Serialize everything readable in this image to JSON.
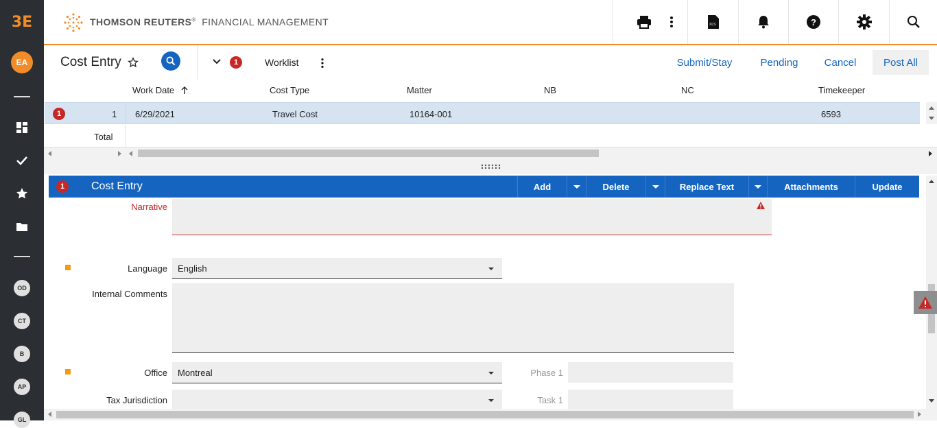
{
  "app": {
    "logo": "3E",
    "brand_bold": "THOMSON REUTERS",
    "brand_mark": "®",
    "brand_rest": "FINANCIAL MANAGEMENT"
  },
  "sidebar": {
    "user_initials": "EA",
    "recent": [
      "OD",
      "CT",
      "B",
      "AP",
      "GL"
    ]
  },
  "titlebar": {
    "title": "Cost Entry",
    "worklist_badge": "1",
    "worklist_label": "Worklist",
    "actions": [
      "Submit/Stay",
      "Pending",
      "Cancel",
      "Post All"
    ]
  },
  "grid": {
    "columns": [
      "Work Date",
      "Cost Type",
      "Matter",
      "NB",
      "NC",
      "Timekeeper"
    ],
    "row": {
      "badge": "1",
      "index": "1",
      "work_date": "6/29/2021",
      "cost_type": "Travel Cost",
      "matter": "10164-001",
      "nb": "",
      "nc": "",
      "timekeeper": "6593"
    },
    "total_label": "Total"
  },
  "form": {
    "badge": "1",
    "title": "Cost Entry",
    "buttons": {
      "add": "Add",
      "delete": "Delete",
      "replace_text": "Replace Text",
      "attachments": "Attachments",
      "update": "Update"
    },
    "narrative_label": "Narrative",
    "language_label": "Language",
    "language_value": "English",
    "internal_comments_label": "Internal Comments",
    "office_label": "Office",
    "office_value": "Montreal",
    "tax_label": "Tax Jurisdiction",
    "tax_value": "",
    "phase_label": "Phase 1",
    "task_label": "Task 1"
  },
  "colors": {
    "accent": "#f28c28",
    "primary": "#1565c0",
    "error": "#c62828",
    "sidebar": "#2b2f33"
  }
}
